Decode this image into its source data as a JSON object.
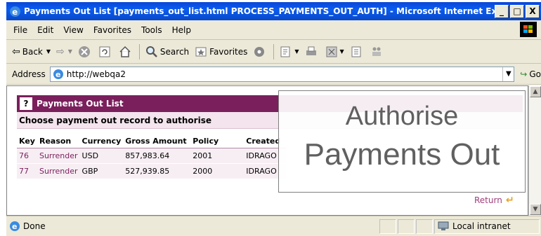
{
  "window": {
    "title": "Payments Out List [payments_out_list.html PROCESS_PAYMENTS_OUT_AUTH] - Microsoft Internet Expl...",
    "minimize": "_",
    "maximize": "□",
    "close": "X"
  },
  "menu": [
    "File",
    "Edit",
    "View",
    "Favorites",
    "Tools",
    "Help"
  ],
  "toolbar": {
    "back_label": "Back",
    "search_label": "Search",
    "favorites_label": "Favorites"
  },
  "address": {
    "label": "Address",
    "url": "http://webqa2",
    "go_label": "Go"
  },
  "panel": {
    "title": "Payments Out List",
    "subtitle": "Choose payment out record to authorise",
    "columns": [
      "Key",
      "Reason",
      "Currency",
      "Gross Amount",
      "Policy",
      "Created"
    ],
    "rows": [
      {
        "key": "76",
        "reason": "Surrender",
        "currency": "USD",
        "amount": "857,983.64",
        "policy": "2001",
        "created": "IDRAGO"
      },
      {
        "key": "77",
        "reason": "Surrender",
        "currency": "GBP",
        "amount": "527,939.85",
        "policy": "2000",
        "created": "IDRAGO"
      }
    ],
    "return_label": "Return"
  },
  "overlay": {
    "line1": "Authorise",
    "line2": "Payments Out"
  },
  "status": {
    "text": "Done",
    "zone": "Local intranet"
  }
}
